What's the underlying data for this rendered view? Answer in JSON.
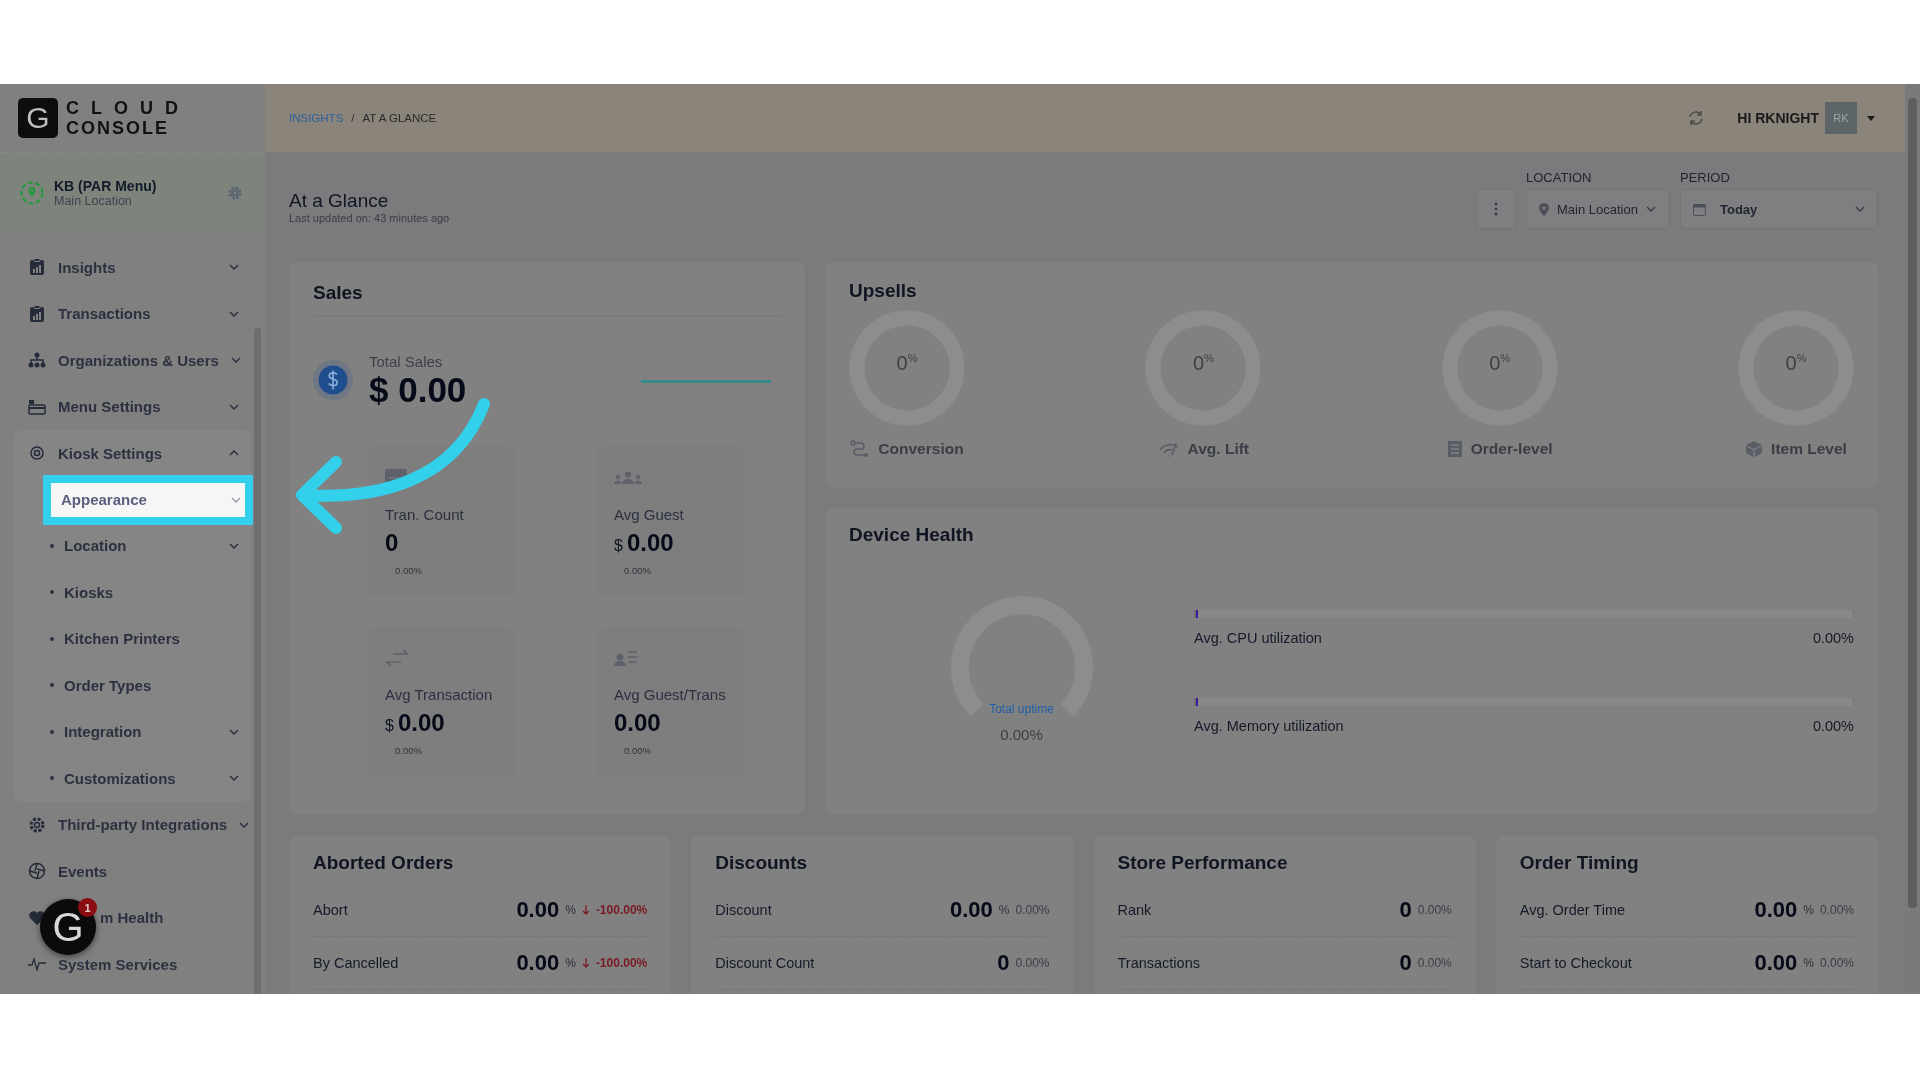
{
  "logo": {
    "letter": "G",
    "line1": "CLOUD",
    "line2": "CONSOLE"
  },
  "store": {
    "name": "KB (PAR Menu)",
    "location": "Main Location"
  },
  "sidebar": {
    "items": [
      {
        "label": "Insights",
        "expandable": true,
        "expanded": false
      },
      {
        "label": "Transactions",
        "expandable": true,
        "expanded": false
      },
      {
        "label": "Organizations & Users",
        "expandable": true,
        "expanded": false
      },
      {
        "label": "Menu Settings",
        "expandable": true,
        "expanded": false
      },
      {
        "label": "Kiosk Settings",
        "expandable": true,
        "expanded": true,
        "children": [
          {
            "label": "Appearance",
            "expandable": true,
            "selected": true
          },
          {
            "label": "Location",
            "expandable": true,
            "selected": false
          },
          {
            "label": "Kiosks",
            "expandable": false,
            "selected": false
          },
          {
            "label": "Kitchen Printers",
            "expandable": false,
            "selected": false
          },
          {
            "label": "Order Types",
            "expandable": false,
            "selected": false
          },
          {
            "label": "Integration",
            "expandable": true,
            "selected": false
          },
          {
            "label": "Customizations",
            "expandable": true,
            "selected": false
          }
        ]
      },
      {
        "label": "Third-party Integrations",
        "expandable": true,
        "expanded": false
      },
      {
        "label": "Events",
        "expandable": false
      },
      {
        "label": "m Health",
        "expandable": false
      },
      {
        "label": "System Services",
        "expandable": false
      }
    ]
  },
  "assistant": {
    "letter": "G",
    "badge": "1"
  },
  "breadcrumb": [
    {
      "label": "INSIGHTS",
      "kind": "link"
    },
    {
      "label": "AT A GLANCE",
      "kind": "current"
    }
  ],
  "breadcrumb_separator": "/",
  "user": {
    "greeting": "HI RKNIGHT",
    "initials": "RK"
  },
  "page": {
    "title": "At a Glance",
    "updated": "Last updated on: 43 minutes ago"
  },
  "filters": [
    {
      "label": "LOCATION",
      "value": "Main Location",
      "kind": "location"
    },
    {
      "label": "PERIOD",
      "value": "Today",
      "kind": "period"
    }
  ],
  "sales": {
    "title": "Sales",
    "total_label": "Total Sales",
    "total_value": "$ 0.00",
    "metrics": [
      {
        "label": "Tran. Count",
        "value": "0",
        "change": "0.00%"
      },
      {
        "label": "Avg Guest",
        "currency": "$",
        "value": "0.00",
        "change": "0.00%"
      },
      {
        "label": "Avg Transaction",
        "currency": "$",
        "value": "0.00",
        "change": "0.00%"
      },
      {
        "label": "Avg Guest/Trans",
        "value": "0.00",
        "change": "0.00%"
      }
    ]
  },
  "upsells": {
    "title": "Upsells",
    "items": [
      {
        "label": "Conversion",
        "value": "0",
        "unit": "%"
      },
      {
        "label": "Avg. Lift",
        "value": "0",
        "unit": "%"
      },
      {
        "label": "Order-level",
        "value": "0",
        "unit": "%"
      },
      {
        "label": "Item Level",
        "value": "0",
        "unit": "%"
      }
    ]
  },
  "device_health": {
    "title": "Device Health",
    "uptime": {
      "label": "Total uptime",
      "value": "0.00%"
    },
    "bars": [
      {
        "label": "Avg. CPU utilization",
        "value": "0.00%",
        "level": 0
      },
      {
        "label": "Avg. Memory utilization",
        "value": "0.00%",
        "level": 0
      }
    ]
  },
  "cards": [
    {
      "title": "Aborted Orders",
      "rows": [
        {
          "label": "Abort",
          "value": "0.00",
          "unit": "%",
          "kind": "decrease",
          "change": "-100.00%"
        },
        {
          "label": "By Cancelled",
          "value": "0.00",
          "unit": "%",
          "kind": "decrease",
          "change": "-100.00%"
        }
      ]
    },
    {
      "title": "Discounts",
      "rows": [
        {
          "label": "Discount",
          "value": "0.00",
          "unit": "%",
          "kind": "neutral",
          "change": "0.00%"
        },
        {
          "label": "Discount Count",
          "value": "0",
          "kind": "neutral",
          "change": "0.00%"
        }
      ]
    },
    {
      "title": "Store Performance",
      "rows": [
        {
          "label": "Rank",
          "value": "0",
          "kind": "neutral",
          "change": "0.00%"
        },
        {
          "label": "Transactions",
          "value": "0",
          "kind": "neutral",
          "change": "0.00%"
        }
      ]
    },
    {
      "title": "Order Timing",
      "rows": [
        {
          "label": "Avg. Order Time",
          "value": "0.00",
          "unit": "%",
          "kind": "neutral",
          "change": "0.00%"
        },
        {
          "label": "Start to Checkout",
          "value": "0.00",
          "unit": "%",
          "kind": "neutral",
          "change": "0.00%"
        }
      ]
    }
  ]
}
